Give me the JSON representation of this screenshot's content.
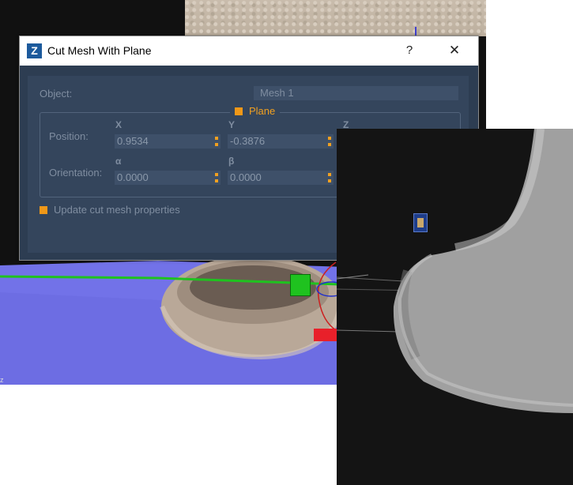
{
  "dialog": {
    "title": "Cut Mesh With Plane",
    "help_label": "?",
    "close_label": "✕",
    "app_icon_letter": "Z"
  },
  "object": {
    "label": "Object:",
    "value": "Mesh 1"
  },
  "plane_group": {
    "title": "Plane",
    "position_label": "Position:",
    "orientation_label": "Orientation:",
    "position_headers": [
      "X",
      "Y",
      "Z"
    ],
    "orientation_headers": [
      "α",
      "β"
    ],
    "position_values": [
      "0.9534",
      "-0.3876"
    ],
    "orientation_values": [
      "0.0000",
      "0.0000"
    ]
  },
  "update_option": {
    "label": "Update cut mesh properties",
    "checked": true
  },
  "viewport": {
    "axis_label": "z"
  },
  "colors": {
    "accent": "#f0a020",
    "dialog_bg": "#2d3d52",
    "arrow": "#e8202a",
    "gizmo": "#1fc21f"
  },
  "icons": [
    "app-logo-icon",
    "help-icon",
    "close-icon",
    "checkbox-icon",
    "spinner-arrows-icon",
    "red-arrow-icon",
    "plane-gizmo-icon"
  ]
}
